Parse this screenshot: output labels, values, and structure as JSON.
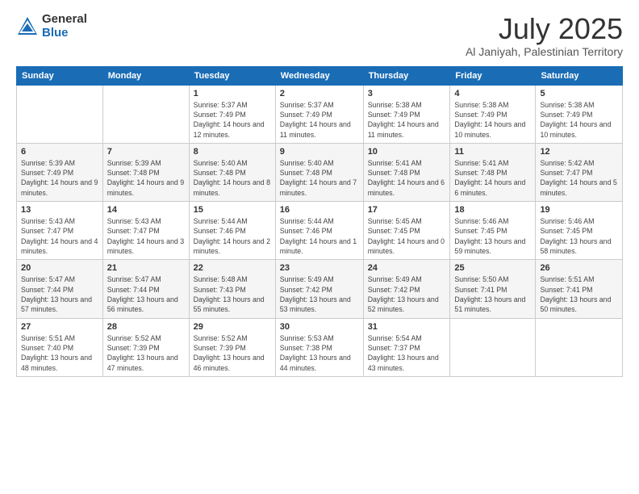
{
  "header": {
    "logo_general": "General",
    "logo_blue": "Blue",
    "title": "July 2025",
    "location": "Al Janiyah, Palestinian Territory"
  },
  "days_of_week": [
    "Sunday",
    "Monday",
    "Tuesday",
    "Wednesday",
    "Thursday",
    "Friday",
    "Saturday"
  ],
  "weeks": [
    [
      {
        "day": "",
        "sunrise": "",
        "sunset": "",
        "daylight": ""
      },
      {
        "day": "",
        "sunrise": "",
        "sunset": "",
        "daylight": ""
      },
      {
        "day": "1",
        "sunrise": "Sunrise: 5:37 AM",
        "sunset": "Sunset: 7:49 PM",
        "daylight": "Daylight: 14 hours and 12 minutes."
      },
      {
        "day": "2",
        "sunrise": "Sunrise: 5:37 AM",
        "sunset": "Sunset: 7:49 PM",
        "daylight": "Daylight: 14 hours and 11 minutes."
      },
      {
        "day": "3",
        "sunrise": "Sunrise: 5:38 AM",
        "sunset": "Sunset: 7:49 PM",
        "daylight": "Daylight: 14 hours and 11 minutes."
      },
      {
        "day": "4",
        "sunrise": "Sunrise: 5:38 AM",
        "sunset": "Sunset: 7:49 PM",
        "daylight": "Daylight: 14 hours and 10 minutes."
      },
      {
        "day": "5",
        "sunrise": "Sunrise: 5:38 AM",
        "sunset": "Sunset: 7:49 PM",
        "daylight": "Daylight: 14 hours and 10 minutes."
      }
    ],
    [
      {
        "day": "6",
        "sunrise": "Sunrise: 5:39 AM",
        "sunset": "Sunset: 7:49 PM",
        "daylight": "Daylight: 14 hours and 9 minutes."
      },
      {
        "day": "7",
        "sunrise": "Sunrise: 5:39 AM",
        "sunset": "Sunset: 7:48 PM",
        "daylight": "Daylight: 14 hours and 9 minutes."
      },
      {
        "day": "8",
        "sunrise": "Sunrise: 5:40 AM",
        "sunset": "Sunset: 7:48 PM",
        "daylight": "Daylight: 14 hours and 8 minutes."
      },
      {
        "day": "9",
        "sunrise": "Sunrise: 5:40 AM",
        "sunset": "Sunset: 7:48 PM",
        "daylight": "Daylight: 14 hours and 7 minutes."
      },
      {
        "day": "10",
        "sunrise": "Sunrise: 5:41 AM",
        "sunset": "Sunset: 7:48 PM",
        "daylight": "Daylight: 14 hours and 6 minutes."
      },
      {
        "day": "11",
        "sunrise": "Sunrise: 5:41 AM",
        "sunset": "Sunset: 7:48 PM",
        "daylight": "Daylight: 14 hours and 6 minutes."
      },
      {
        "day": "12",
        "sunrise": "Sunrise: 5:42 AM",
        "sunset": "Sunset: 7:47 PM",
        "daylight": "Daylight: 14 hours and 5 minutes."
      }
    ],
    [
      {
        "day": "13",
        "sunrise": "Sunrise: 5:43 AM",
        "sunset": "Sunset: 7:47 PM",
        "daylight": "Daylight: 14 hours and 4 minutes."
      },
      {
        "day": "14",
        "sunrise": "Sunrise: 5:43 AM",
        "sunset": "Sunset: 7:47 PM",
        "daylight": "Daylight: 14 hours and 3 minutes."
      },
      {
        "day": "15",
        "sunrise": "Sunrise: 5:44 AM",
        "sunset": "Sunset: 7:46 PM",
        "daylight": "Daylight: 14 hours and 2 minutes."
      },
      {
        "day": "16",
        "sunrise": "Sunrise: 5:44 AM",
        "sunset": "Sunset: 7:46 PM",
        "daylight": "Daylight: 14 hours and 1 minute."
      },
      {
        "day": "17",
        "sunrise": "Sunrise: 5:45 AM",
        "sunset": "Sunset: 7:45 PM",
        "daylight": "Daylight: 14 hours and 0 minutes."
      },
      {
        "day": "18",
        "sunrise": "Sunrise: 5:46 AM",
        "sunset": "Sunset: 7:45 PM",
        "daylight": "Daylight: 13 hours and 59 minutes."
      },
      {
        "day": "19",
        "sunrise": "Sunrise: 5:46 AM",
        "sunset": "Sunset: 7:45 PM",
        "daylight": "Daylight: 13 hours and 58 minutes."
      }
    ],
    [
      {
        "day": "20",
        "sunrise": "Sunrise: 5:47 AM",
        "sunset": "Sunset: 7:44 PM",
        "daylight": "Daylight: 13 hours and 57 minutes."
      },
      {
        "day": "21",
        "sunrise": "Sunrise: 5:47 AM",
        "sunset": "Sunset: 7:44 PM",
        "daylight": "Daylight: 13 hours and 56 minutes."
      },
      {
        "day": "22",
        "sunrise": "Sunrise: 5:48 AM",
        "sunset": "Sunset: 7:43 PM",
        "daylight": "Daylight: 13 hours and 55 minutes."
      },
      {
        "day": "23",
        "sunrise": "Sunrise: 5:49 AM",
        "sunset": "Sunset: 7:42 PM",
        "daylight": "Daylight: 13 hours and 53 minutes."
      },
      {
        "day": "24",
        "sunrise": "Sunrise: 5:49 AM",
        "sunset": "Sunset: 7:42 PM",
        "daylight": "Daylight: 13 hours and 52 minutes."
      },
      {
        "day": "25",
        "sunrise": "Sunrise: 5:50 AM",
        "sunset": "Sunset: 7:41 PM",
        "daylight": "Daylight: 13 hours and 51 minutes."
      },
      {
        "day": "26",
        "sunrise": "Sunrise: 5:51 AM",
        "sunset": "Sunset: 7:41 PM",
        "daylight": "Daylight: 13 hours and 50 minutes."
      }
    ],
    [
      {
        "day": "27",
        "sunrise": "Sunrise: 5:51 AM",
        "sunset": "Sunset: 7:40 PM",
        "daylight": "Daylight: 13 hours and 48 minutes."
      },
      {
        "day": "28",
        "sunrise": "Sunrise: 5:52 AM",
        "sunset": "Sunset: 7:39 PM",
        "daylight": "Daylight: 13 hours and 47 minutes."
      },
      {
        "day": "29",
        "sunrise": "Sunrise: 5:52 AM",
        "sunset": "Sunset: 7:39 PM",
        "daylight": "Daylight: 13 hours and 46 minutes."
      },
      {
        "day": "30",
        "sunrise": "Sunrise: 5:53 AM",
        "sunset": "Sunset: 7:38 PM",
        "daylight": "Daylight: 13 hours and 44 minutes."
      },
      {
        "day": "31",
        "sunrise": "Sunrise: 5:54 AM",
        "sunset": "Sunset: 7:37 PM",
        "daylight": "Daylight: 13 hours and 43 minutes."
      },
      {
        "day": "",
        "sunrise": "",
        "sunset": "",
        "daylight": ""
      },
      {
        "day": "",
        "sunrise": "",
        "sunset": "",
        "daylight": ""
      }
    ]
  ]
}
